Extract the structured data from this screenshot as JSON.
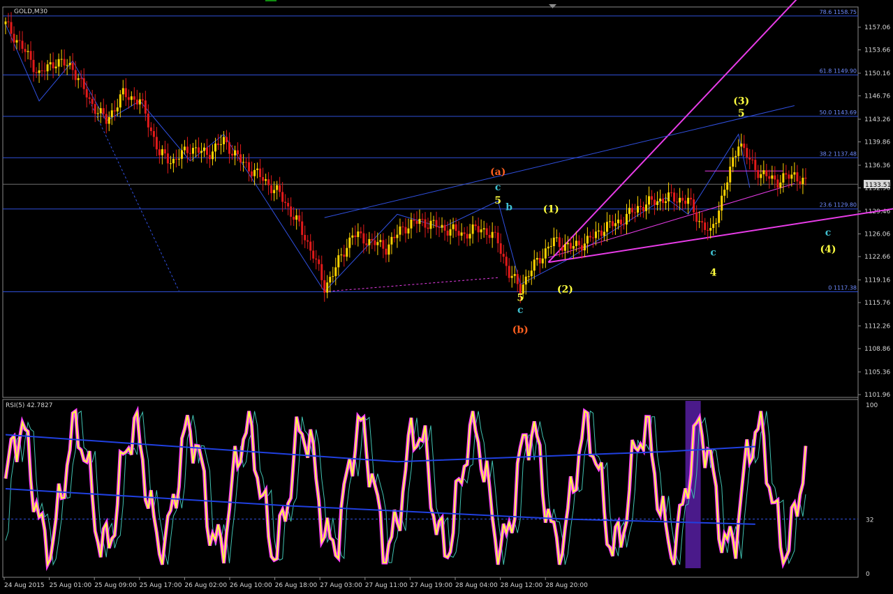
{
  "window": {
    "symbol_label": "GOLD,M30",
    "rsi_label": "RSI(5) 42.7827"
  },
  "colors": {
    "background": "#000000",
    "bull": "#ffd400",
    "bear": "#e31a1a",
    "grid": "#2f4fd8",
    "magenta": "#e83ce8",
    "rsi_main": "#ffff40",
    "rsi_shadow": "#ff40ff"
  },
  "chart_data": [
    {
      "type": "candlestick",
      "title": "GOLD,M30",
      "ylim": [
        1101.96,
        1160.6
      ],
      "yticks": [
        "1157.06",
        "1153.66",
        "1150.16",
        "1146.76",
        "1143.26",
        "1139.86",
        "1136.36",
        "1132.96",
        "1129.46",
        "1126.06",
        "1122.66",
        "1119.16",
        "1115.76",
        "1112.26",
        "1108.86",
        "1105.36",
        "1101.96"
      ],
      "xtick_labels": [
        "24 Aug 2015",
        "25 Aug 01:00",
        "25 Aug 09:00",
        "25 Aug 17:00",
        "26 Aug 02:00",
        "26 Aug 10:00",
        "26 Aug 18:00",
        "27 Aug 03:00",
        "27 Aug 11:00",
        "27 Aug 19:00",
        "28 Aug 04:00",
        "28 Aug 12:00",
        "28 Aug 20:00"
      ],
      "current_price": "1133.51",
      "fibonacci_levels": [
        {
          "label": "78.6 1158.75",
          "value": 1158.75
        },
        {
          "label": "61.8 1149.90",
          "value": 1149.9
        },
        {
          "label": "50.0 1143.69",
          "value": 1143.69
        },
        {
          "label": "38.2 1137.48",
          "value": 1137.48
        },
        {
          "label": "23.6 1129.80",
          "value": 1129.8
        },
        {
          "label": "0 1117.38",
          "value": 1117.38
        }
      ],
      "price_path": [
        [
          0,
          1157.5
        ],
        [
          6,
          1154
        ],
        [
          12,
          1150
        ],
        [
          18,
          1152
        ],
        [
          24,
          1151
        ],
        [
          30,
          1146
        ],
        [
          36,
          1143
        ],
        [
          42,
          1147
        ],
        [
          48,
          1146
        ],
        [
          50,
          1144
        ],
        [
          55,
          1138
        ],
        [
          60,
          1137
        ],
        [
          66,
          1139
        ],
        [
          72,
          1138
        ],
        [
          78,
          1140
        ],
        [
          84,
          1137
        ],
        [
          90,
          1135
        ],
        [
          98,
          1132
        ],
        [
          104,
          1128
        ],
        [
          110,
          1123
        ],
        [
          114,
          1118
        ],
        [
          118,
          1121
        ],
        [
          124,
          1126
        ],
        [
          130,
          1125
        ],
        [
          136,
          1124
        ],
        [
          142,
          1127
        ],
        [
          148,
          1128
        ],
        [
          156,
          1127
        ],
        [
          164,
          1126
        ],
        [
          170,
          1127
        ],
        [
          176,
          1125
        ],
        [
          180,
          1120
        ],
        [
          184,
          1118
        ],
        [
          190,
          1122
        ],
        [
          196,
          1125
        ],
        [
          202,
          1124
        ],
        [
          208,
          1125
        ],
        [
          214,
          1127
        ],
        [
          220,
          1128
        ],
        [
          226,
          1130
        ],
        [
          232,
          1131
        ],
        [
          238,
          1131.5
        ],
        [
          244,
          1131
        ],
        [
          248,
          1128
        ],
        [
          252,
          1126
        ],
        [
          258,
          1134
        ],
        [
          262,
          1140
        ],
        [
          266,
          1137
        ],
        [
          270,
          1135
        ],
        [
          276,
          1134
        ],
        [
          282,
          1135
        ],
        [
          286,
          1133.5
        ]
      ],
      "wave_labels": [
        {
          "text": "(a)",
          "x": 176,
          "y": 1134.9,
          "color": "#ff6020"
        },
        {
          "text": "c",
          "x": 176,
          "y": 1132.6,
          "color": "#40c0d0"
        },
        {
          "text": "5",
          "x": 176,
          "y": 1130.6,
          "color": "#ffff40"
        },
        {
          "text": "b",
          "x": 180,
          "y": 1129.6,
          "color": "#40c0d0"
        },
        {
          "text": "(1)",
          "x": 195,
          "y": 1129.3,
          "color": "#ffff40"
        },
        {
          "text": "(b)",
          "x": 184,
          "y": 1111.2,
          "color": "#ff6020"
        },
        {
          "text": "c",
          "x": 184,
          "y": 1114.2,
          "color": "#40c0d0"
        },
        {
          "text": "5",
          "x": 184,
          "y": 1116.0,
          "color": "#ffff40"
        },
        {
          "text": "(2)",
          "x": 200,
          "y": 1117.3,
          "color": "#ffff40"
        },
        {
          "text": "(3)",
          "x": 263,
          "y": 1145.5,
          "color": "#ffff40"
        },
        {
          "text": "5",
          "x": 263,
          "y": 1143.7,
          "color": "#ffff40"
        },
        {
          "text": "(4)",
          "x": 294,
          "y": 1123.3,
          "color": "#ffff40"
        },
        {
          "text": "c",
          "x": 294,
          "y": 1125.8,
          "color": "#40c0d0"
        },
        {
          "text": "4",
          "x": 253,
          "y": 1119.8,
          "color": "#ffff40"
        },
        {
          "text": "c",
          "x": 253,
          "y": 1122.8,
          "color": "#40c0d0"
        }
      ]
    },
    {
      "type": "line",
      "title": "RSI(5) 42.7827",
      "ylim": [
        0,
        100
      ],
      "yticks": [
        "100",
        "32",
        "0"
      ],
      "level": 32,
      "value": 42.7827
    }
  ]
}
